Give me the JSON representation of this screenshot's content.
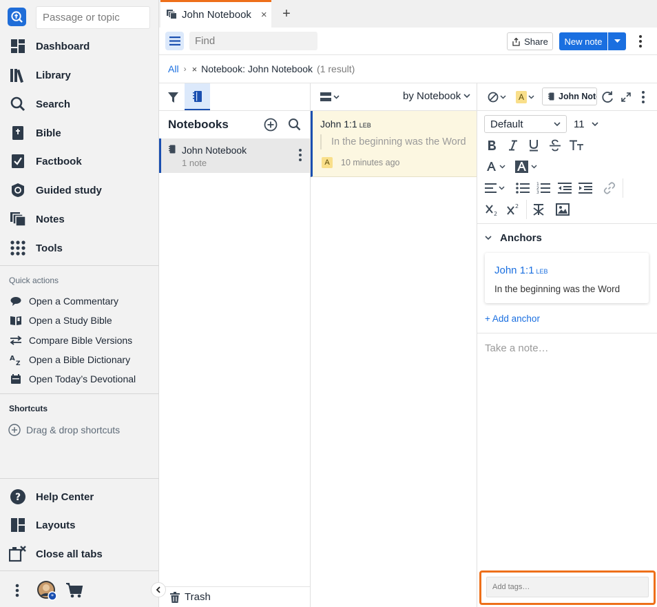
{
  "sidebar": {
    "search_placeholder": "Passage or topic",
    "nav": [
      {
        "label": "Dashboard",
        "icon": "dashboard-icon"
      },
      {
        "label": "Library",
        "icon": "library-icon"
      },
      {
        "label": "Search",
        "icon": "search-icon"
      },
      {
        "label": "Bible",
        "icon": "bible-icon"
      },
      {
        "label": "Factbook",
        "icon": "factbook-icon"
      },
      {
        "label": "Guided study",
        "icon": "guided-study-icon"
      },
      {
        "label": "Notes",
        "icon": "notes-icon"
      },
      {
        "label": "Tools",
        "icon": "tools-icon"
      }
    ],
    "quick_actions_title": "Quick actions",
    "quick_actions": [
      {
        "label": "Open a Commentary",
        "icon": "commentary-icon"
      },
      {
        "label": "Open a Study Bible",
        "icon": "study-bible-icon"
      },
      {
        "label": "Compare Bible Versions",
        "icon": "compare-icon"
      },
      {
        "label": "Open a Bible Dictionary",
        "icon": "dictionary-icon"
      },
      {
        "label": "Open Today’s Devotional",
        "icon": "calendar-icon"
      }
    ],
    "shortcuts_title": "Shortcuts",
    "shortcuts_hint": "Drag & drop shortcuts",
    "bottom_nav": [
      {
        "label": "Help Center",
        "icon": "help-icon"
      },
      {
        "label": "Layouts",
        "icon": "layouts-icon"
      },
      {
        "label": "Close all tabs",
        "icon": "close-tabs-icon"
      }
    ]
  },
  "tab": {
    "title": "John Notebook",
    "close_glyph": "×",
    "add_glyph": "+"
  },
  "toolbar": {
    "find_placeholder": "Find",
    "share_label": "Share",
    "new_note_label": "New note"
  },
  "breadcrumb": {
    "all": "All",
    "separator": "›",
    "remove_glyph": "×",
    "filter": "Notebook: John Notebook",
    "count": "(1 result)"
  },
  "notebooks": {
    "title": "Notebooks",
    "items": [
      {
        "name": "John Notebook",
        "count": "1 note"
      }
    ],
    "trash_label": "Trash"
  },
  "notes": {
    "sort_label": "by Notebook",
    "items": [
      {
        "reference": "John 1:1",
        "version": "LEB",
        "quote": "In the beginning was the Word",
        "badge": "A",
        "time": "10 minutes ago"
      }
    ]
  },
  "editor": {
    "highlight_badge": "A",
    "notebook_chip": "John Notebook",
    "style_value": "Default",
    "size_value": "11",
    "anchors_title": "Anchors",
    "anchor": {
      "reference": "John 1:1",
      "version": "LEB",
      "text": "In the beginning was the Word"
    },
    "add_anchor_label": "+ Add anchor",
    "note_placeholder": "Take a note…",
    "tags_placeholder": "Add tags…"
  },
  "colors": {
    "accent": "#1a6fe0",
    "active_tab_border": "#ee6f1a",
    "note_card_bg": "#fcf7e1",
    "highlight_badge": "#f9df8a"
  }
}
